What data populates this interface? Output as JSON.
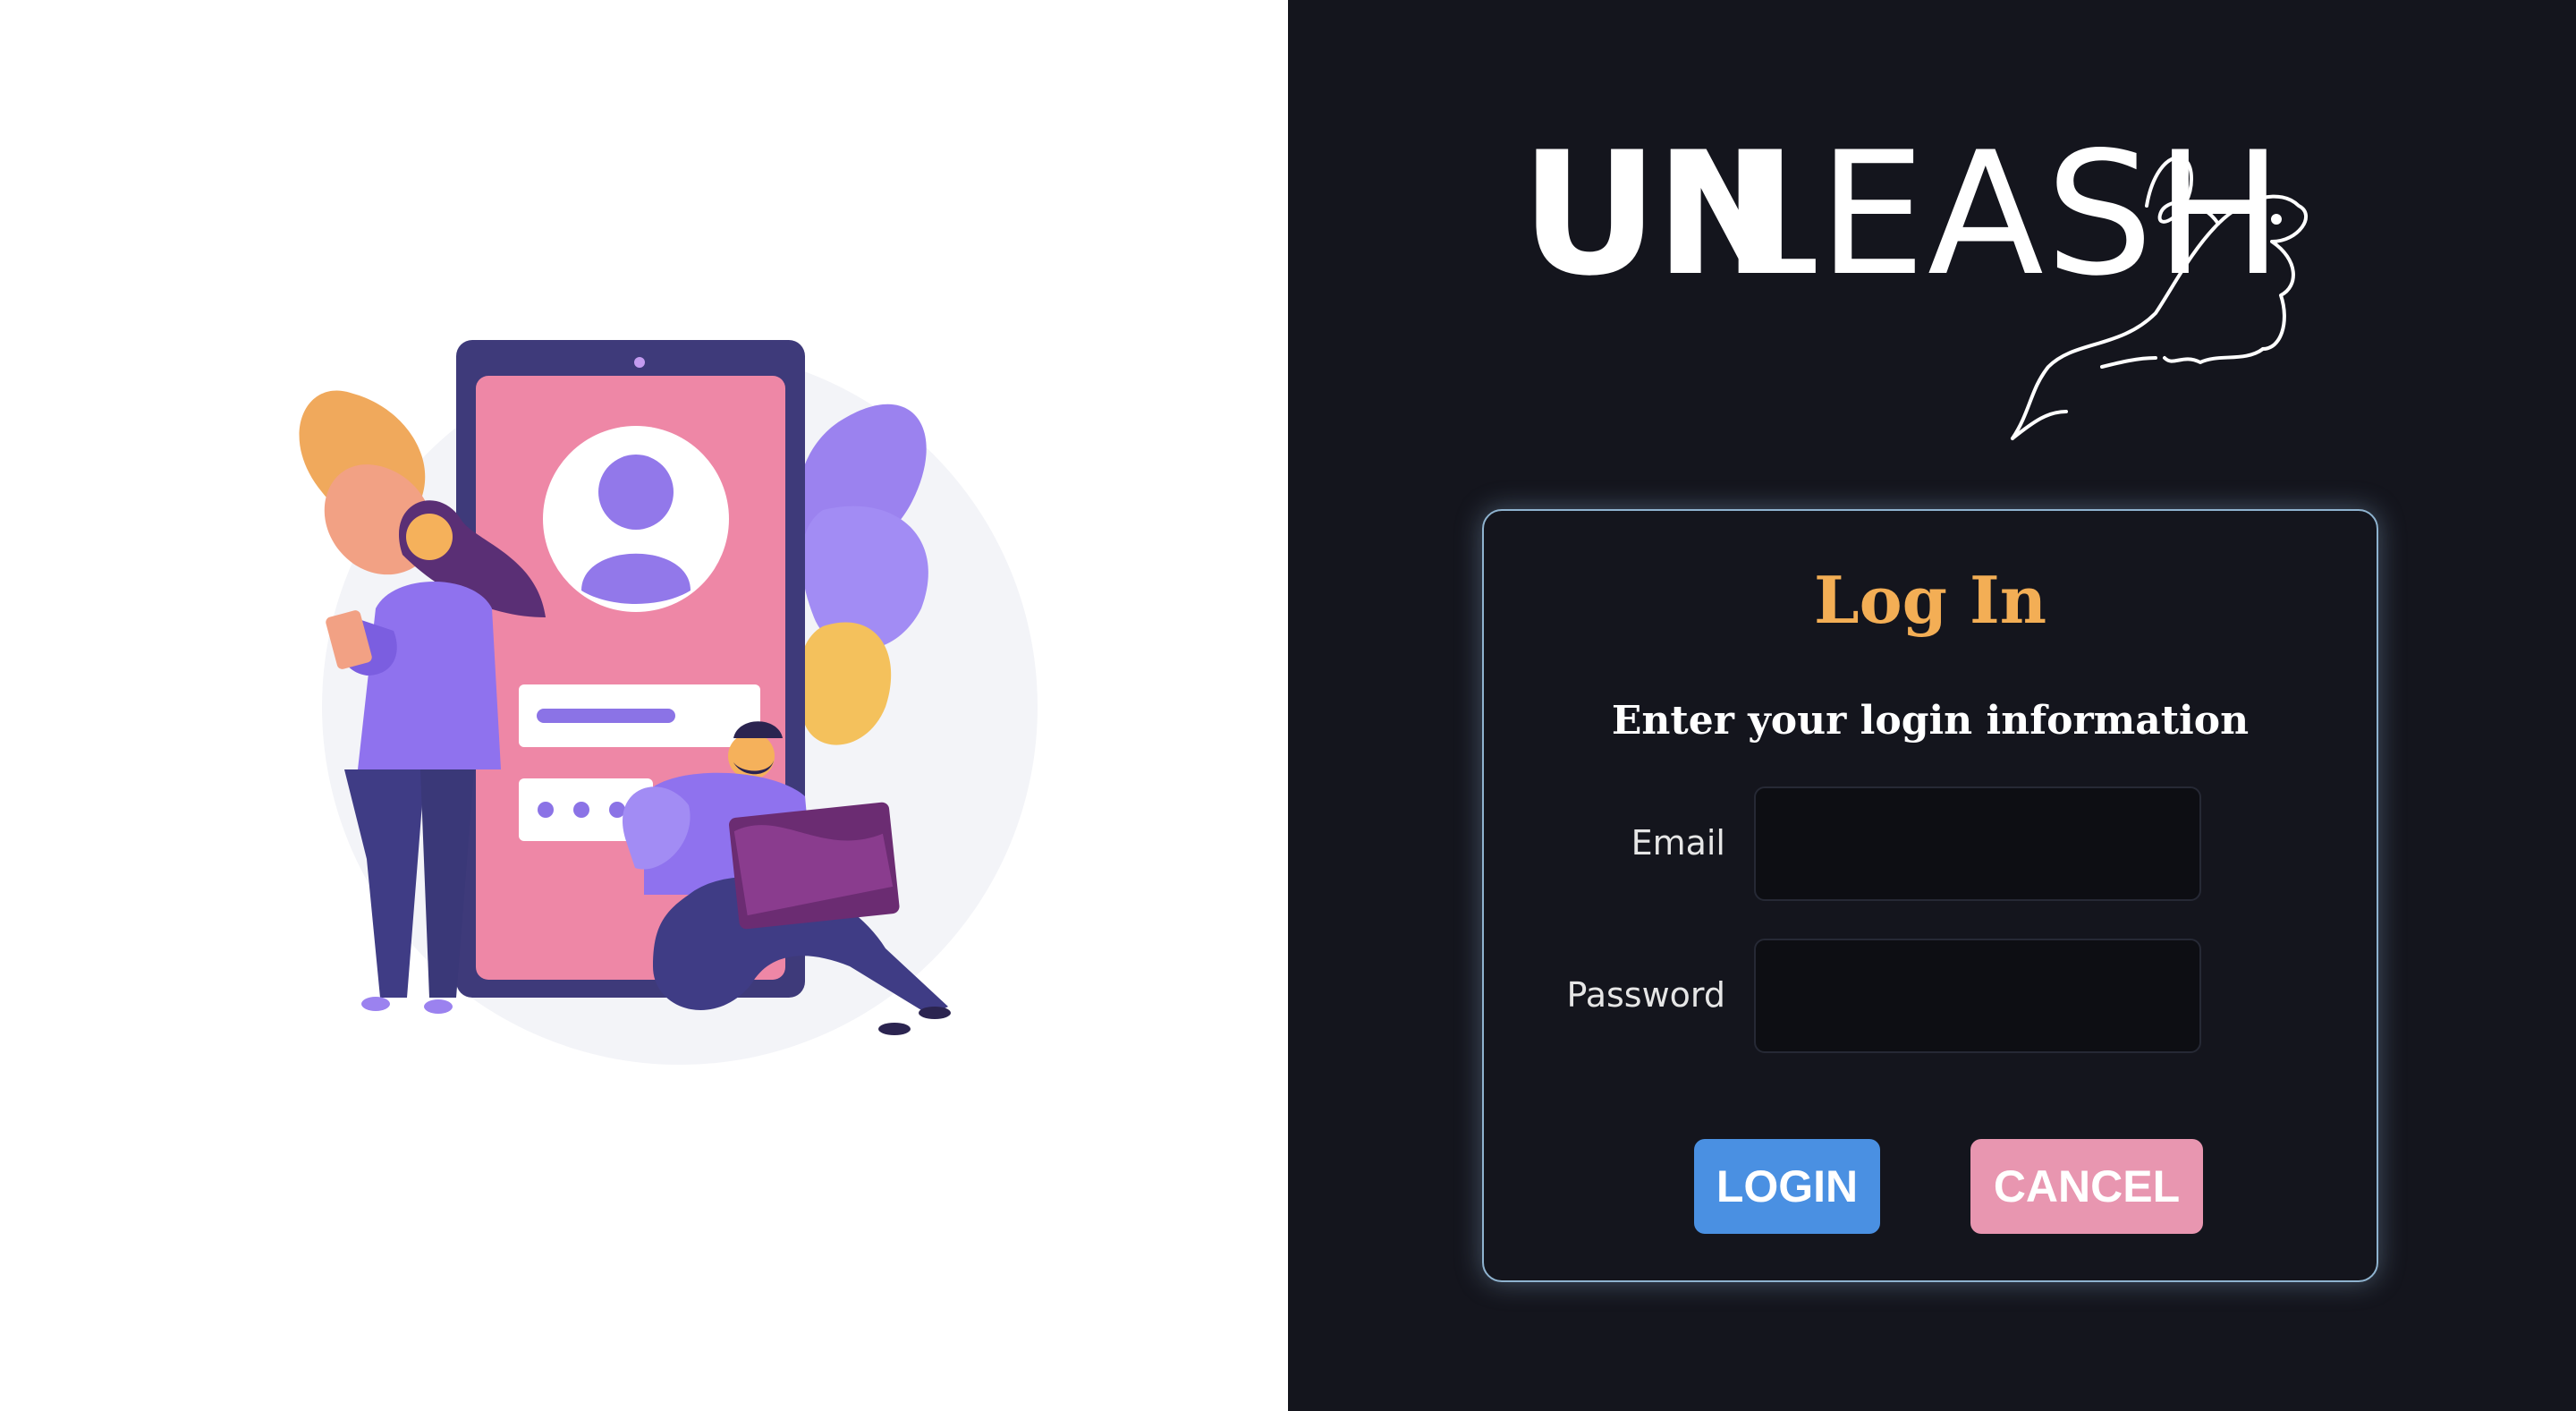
{
  "brand": {
    "part1": "UN",
    "part2": "LEASH"
  },
  "login_card": {
    "title": "Log In",
    "subtitle": "Enter your login information",
    "email_label": "Email",
    "email_value": "",
    "password_label": "Password",
    "password_value": "",
    "login_button": "LOGIN",
    "cancel_button": "CANCEL"
  },
  "colors": {
    "right_bg": "#14151d",
    "title": "#f3ae55",
    "login_button": "#4a90e2",
    "cancel_button": "#e896b0",
    "card_border": "#8fb3cf"
  },
  "illustration": {
    "icon": "login-illustration"
  },
  "logo": {
    "icon": "dog-mascot-icon"
  }
}
